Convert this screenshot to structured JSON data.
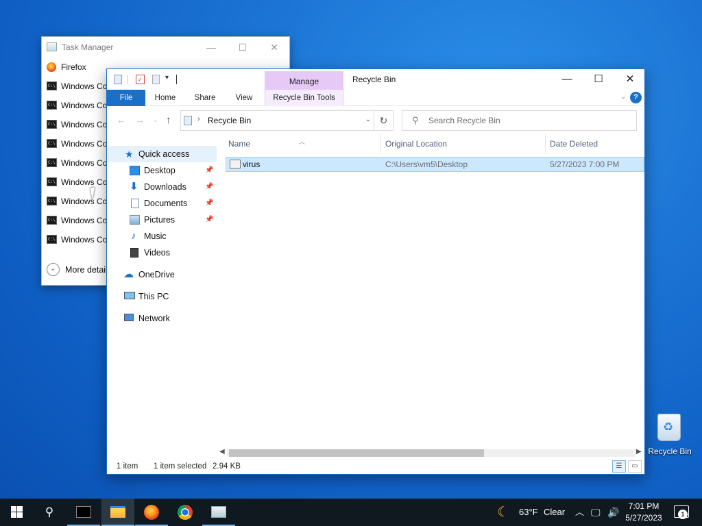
{
  "task_manager": {
    "title": "Task Manager",
    "rows": [
      {
        "label": "Firefox",
        "icon": "firefox-icon"
      },
      {
        "label": "Windows Co",
        "icon": "cmd-icon"
      },
      {
        "label": "Windows Co",
        "icon": "cmd-icon"
      },
      {
        "label": "Windows Co",
        "icon": "cmd-icon"
      },
      {
        "label": "Windows Co",
        "icon": "cmd-icon"
      },
      {
        "label": "Windows Co",
        "icon": "cmd-icon"
      },
      {
        "label": "Windows Co",
        "icon": "cmd-icon"
      },
      {
        "label": "Windows Co",
        "icon": "cmd-icon"
      },
      {
        "label": "Windows Co",
        "icon": "cmd-icon"
      },
      {
        "label": "Windows Co",
        "icon": "cmd-icon"
      }
    ],
    "more_details": "More detail"
  },
  "explorer": {
    "title": "Recycle Bin",
    "manage_tab": "Manage",
    "ribbon_tabs": {
      "file": "File",
      "home": "Home",
      "share": "Share",
      "view": "View",
      "tools": "Recycle Bin Tools"
    },
    "address": "Recycle Bin",
    "search_placeholder": "Search Recycle Bin",
    "nav": {
      "quick_access": "Quick access",
      "desktop": "Desktop",
      "downloads": "Downloads",
      "documents": "Documents",
      "pictures": "Pictures",
      "music": "Music",
      "videos": "Videos",
      "onedrive": "OneDrive",
      "this_pc": "This PC",
      "network": "Network"
    },
    "columns": {
      "name": "Name",
      "original_location": "Original Location",
      "date_deleted": "Date Deleted"
    },
    "files": [
      {
        "name": "virus",
        "original_location": "C:\\Users\\vm5\\Desktop",
        "date_deleted": "5/27/2023 7:00 PM"
      }
    ],
    "status": {
      "count": "1 item",
      "selected": "1 item selected",
      "size": "2.94 KB"
    }
  },
  "desktop": {
    "recycle_bin_label": "Recycle Bin"
  },
  "taskbar": {
    "weather_temp": "63°F",
    "weather_desc": "Clear",
    "time": "7:01 PM",
    "date": "5/27/2023",
    "notification_count": "1",
    "accent": "#76b9ed"
  }
}
